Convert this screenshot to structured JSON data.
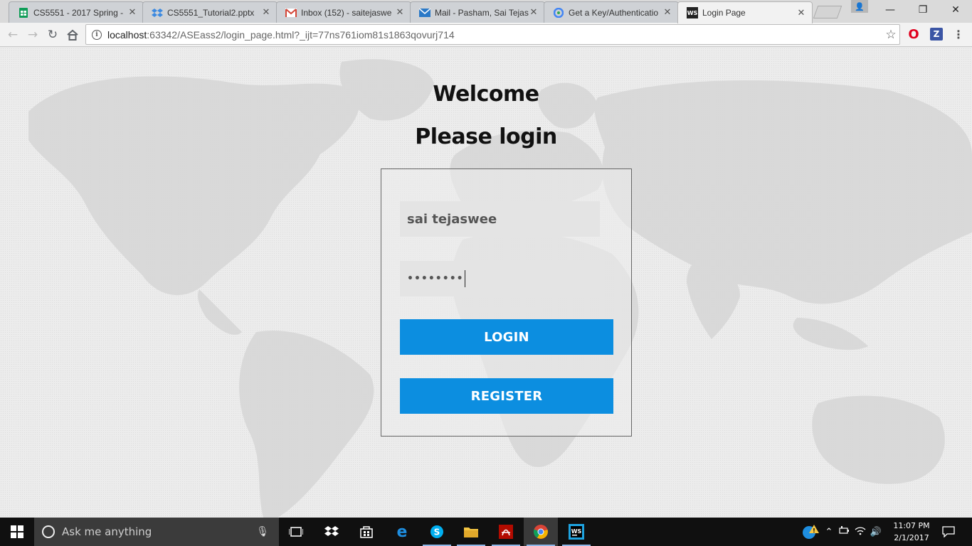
{
  "browser": {
    "tabs": [
      {
        "title": "CS5551 - 2017 Spring -",
        "icon": "sheets-icon",
        "color": "#0f9d58"
      },
      {
        "title": "CS5551_Tutorial2.pptx",
        "icon": "dropbox-icon",
        "color": "#3d8ae0"
      },
      {
        "title": "Inbox (152) - saitejaswe",
        "icon": "gmail-icon",
        "color": "#d44638"
      },
      {
        "title": "Mail - Pasham, Sai Tejas",
        "icon": "mail-icon",
        "color": "#2b79c7"
      },
      {
        "title": "Get a Key/Authenticatio",
        "icon": "google-icon",
        "color": "#4285f4"
      },
      {
        "title": "Login Page",
        "icon": "webstorm-icon",
        "color": "#222222",
        "active": true
      }
    ],
    "url_host": "localhost",
    "url_rest": ":63342/ASEass2/login_page.html?_ijt=77ns761iom81s1863qovurj714"
  },
  "page": {
    "welcome": "Welcome",
    "please_login": "Please login",
    "username_value": "sai tejaswee",
    "password_masked": "••••••••",
    "login_label": "LOGIN",
    "register_label": "REGISTER",
    "accent_color": "#0c8ee0"
  },
  "taskbar": {
    "search_placeholder": "Ask me anything",
    "time": "11:07 PM",
    "date": "2/1/2017"
  }
}
